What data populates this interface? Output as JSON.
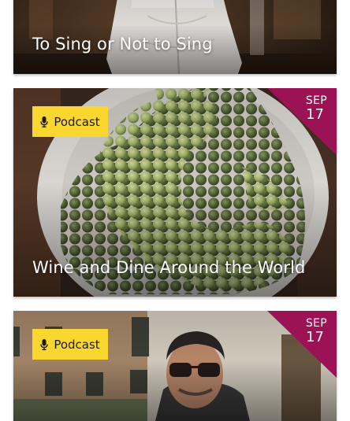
{
  "cards": [
    {
      "title": "To Sing or Not to Sing",
      "image": "woman-in-white-blouse-photo"
    },
    {
      "title": "Wine and Dine Around the World",
      "tag": {
        "label": "Podcast",
        "icon": "microphone-icon"
      },
      "date": {
        "month": "SEP",
        "day": "17"
      },
      "image": "green-grapes-in-bucket-photo"
    },
    {
      "title": "",
      "tag": {
        "label": "Podcast",
        "icon": "microphone-icon"
      },
      "date": {
        "month": "SEP",
        "day": "17"
      },
      "image": "man-with-sunglasses-photo"
    }
  ],
  "colors": {
    "tag_background": "#fad630",
    "date_flag": "#9b1355",
    "card_title": "#ffffff"
  }
}
